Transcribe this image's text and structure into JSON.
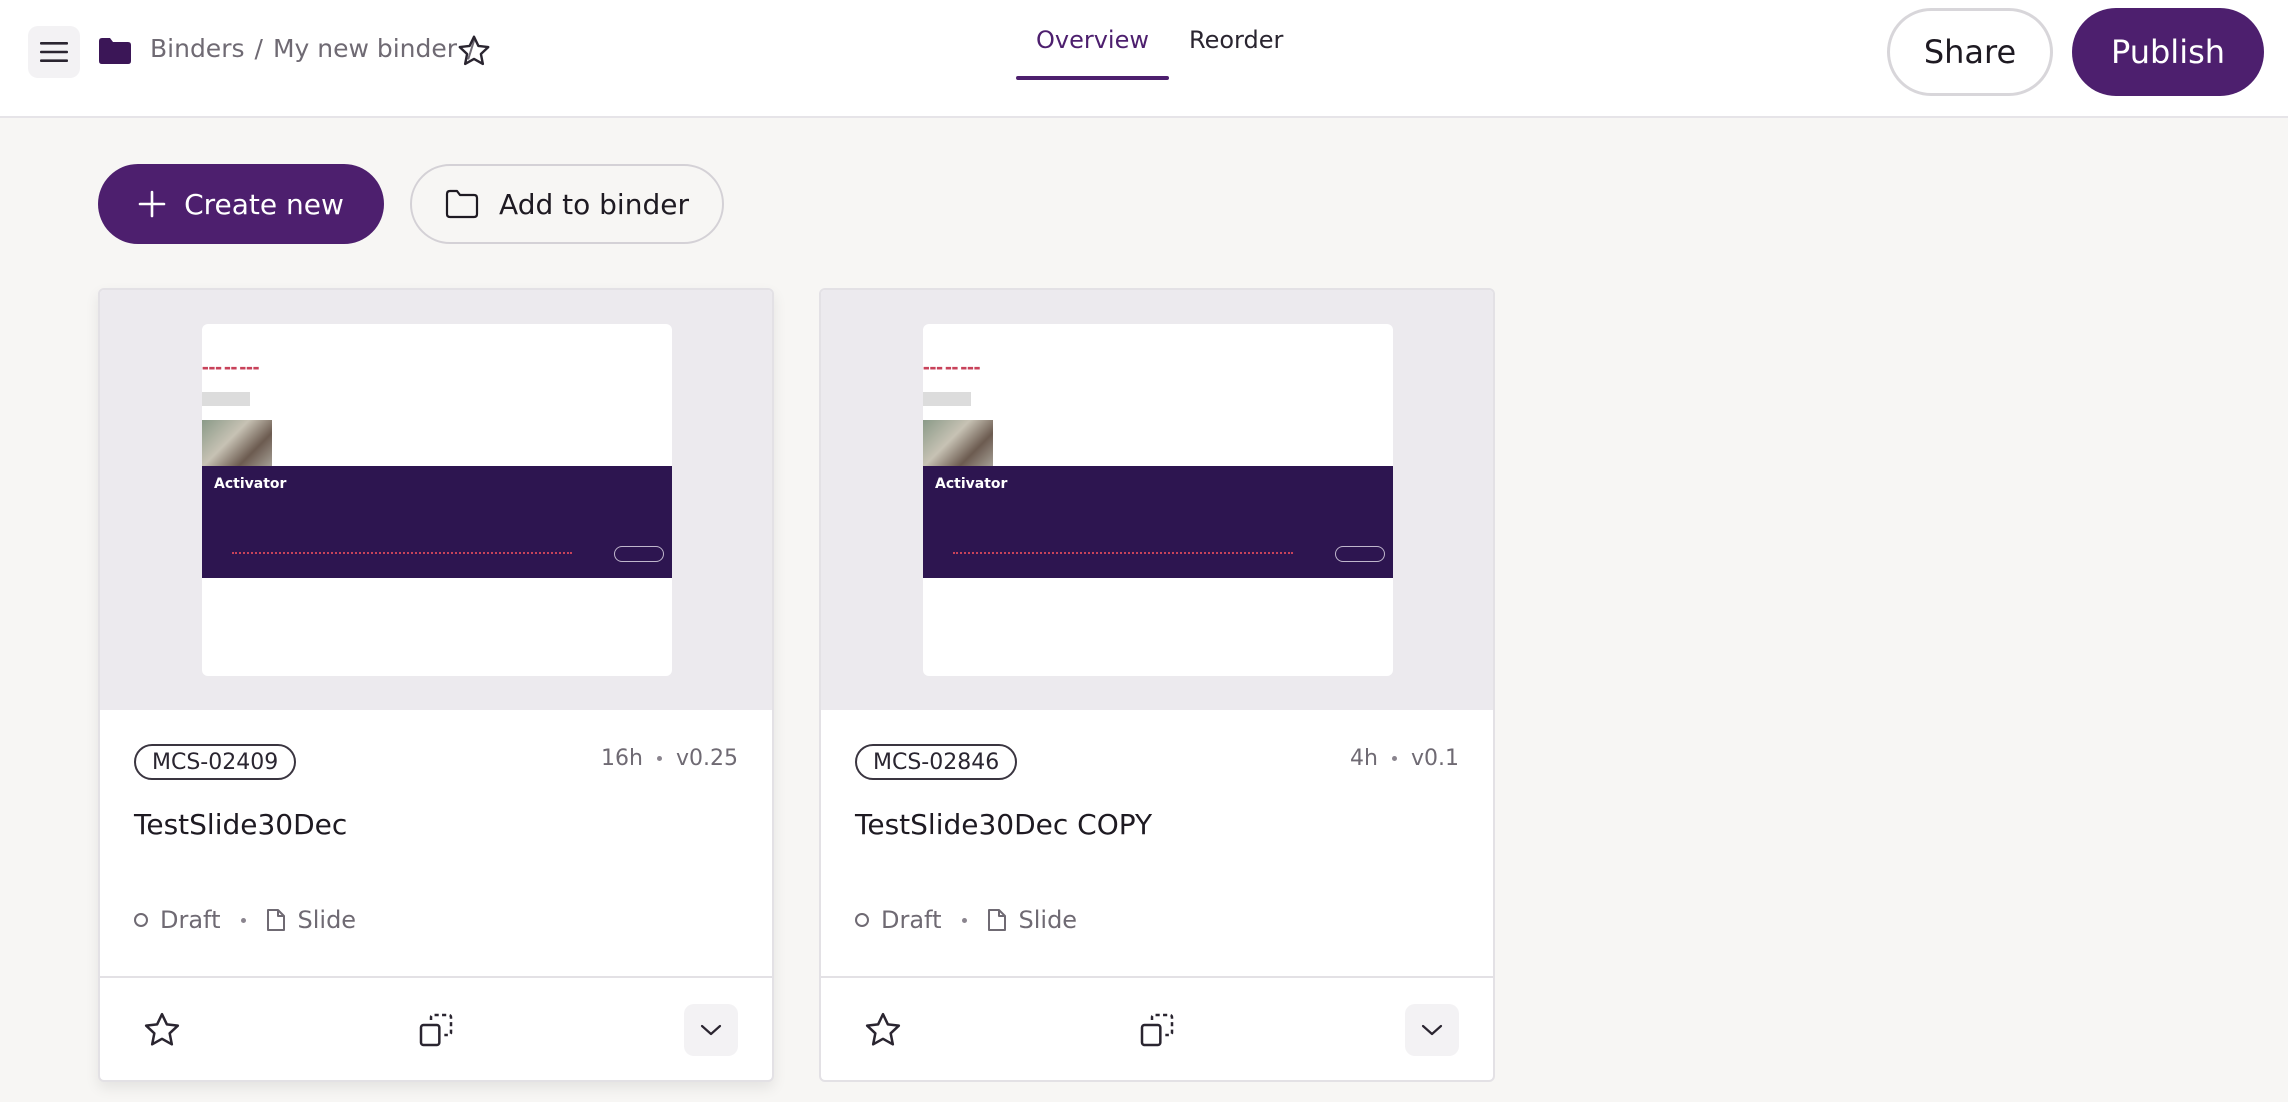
{
  "header": {
    "breadcrumb": [
      "Binders",
      "My new binder"
    ],
    "separator": "/",
    "tabs": [
      {
        "label": "Overview",
        "active": true
      },
      {
        "label": "Reorder",
        "active": false
      }
    ],
    "share_label": "Share",
    "publish_label": "Publish"
  },
  "actions": {
    "create_label": "Create new",
    "add_to_binder_label": "Add to binder"
  },
  "cards": [
    {
      "code": "MCS-02409",
      "age": "16h",
      "version": "v0.25",
      "title": "TestSlide30Dec",
      "status": "Draft",
      "type": "Slide",
      "slide_logo": "Activator"
    },
    {
      "code": "MCS-02846",
      "age": "4h",
      "version": "v0.1",
      "title": "TestSlide30Dec COPY",
      "status": "Draft",
      "type": "Slide",
      "slide_logo": "Activator"
    }
  ],
  "colors": {
    "brand": "#4d1f6e",
    "slide_band": "#2d1550",
    "page_bg": "#f7f6f4"
  },
  "icons": [
    "menu-icon",
    "folder-icon",
    "star-icon",
    "plus-icon",
    "folder-outline-icon",
    "duplicate-icon",
    "chevron-down-icon",
    "document-icon",
    "status-circle-icon"
  ]
}
